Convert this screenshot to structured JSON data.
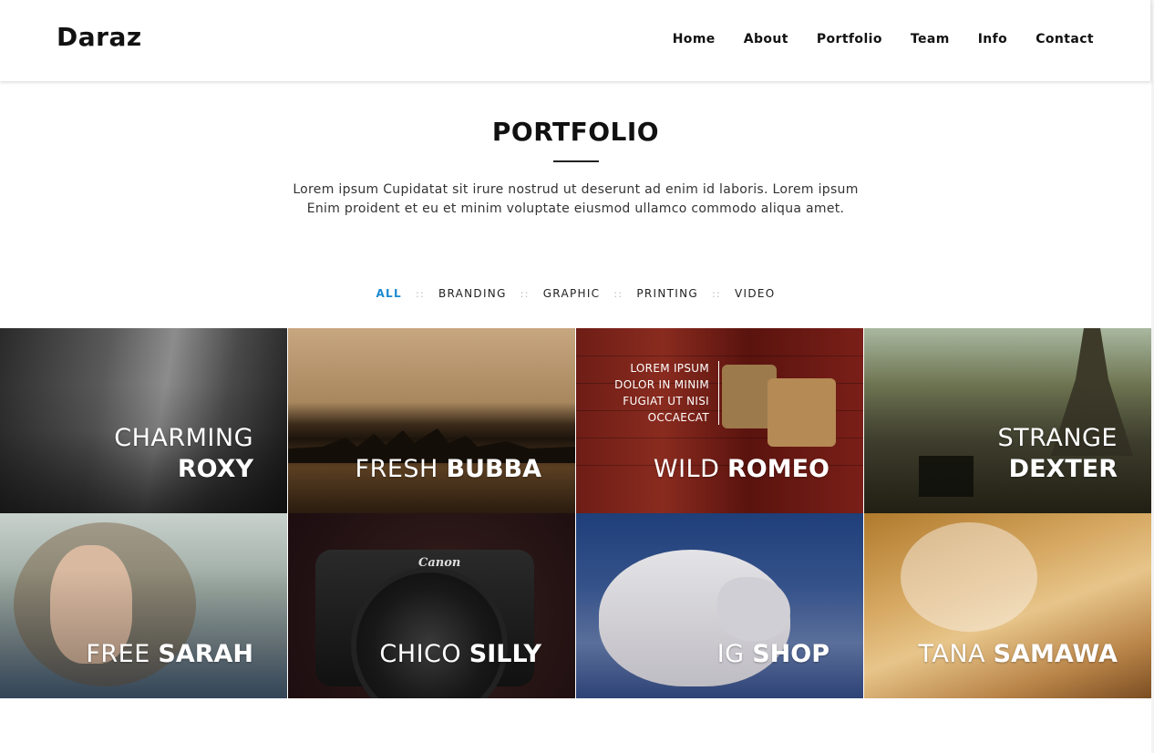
{
  "brand": "Daraz",
  "nav": [
    "Home",
    "About",
    "Portfolio",
    "Team",
    "Info",
    "Contact"
  ],
  "section": {
    "title": "PORTFOLIO",
    "intro_line1": "Lorem ipsum Cupidatat sit irure nostrud ut deserunt ad enim id laboris. Lorem ipsum",
    "intro_line2": "Enim proident et eu et minim voluptate eiusmod ullamco commodo aliqua amet."
  },
  "filters": {
    "items": [
      "ALL",
      "BRANDING",
      "GRAPHIC",
      "PRINTING",
      "VIDEO"
    ],
    "active": "ALL",
    "separator": "::"
  },
  "portfolio": [
    {
      "thin": "CHARMING",
      "bold": "ROXY"
    },
    {
      "thin": "FRESH",
      "bold": "BUBBA"
    },
    {
      "thin": "WILD",
      "bold": "ROMEO",
      "blurb": [
        "LOREM IPSUM",
        "DOLOR IN MINIM",
        "FUGIAT UT NISI",
        "OCCAECAT"
      ]
    },
    {
      "thin": "STRANGE",
      "bold": "DEXTER"
    },
    {
      "thin": "FREE",
      "bold": "SARAH"
    },
    {
      "thin": "CHICO",
      "bold": "SILLY",
      "logo": "Canon"
    },
    {
      "thin": "IG",
      "bold": "SHOP"
    },
    {
      "thin": "TANA",
      "bold": "SAMAWA"
    }
  ],
  "colors": {
    "accent": "#1a8ad2",
    "text": "#111111",
    "separator": "#b8b8b8"
  }
}
